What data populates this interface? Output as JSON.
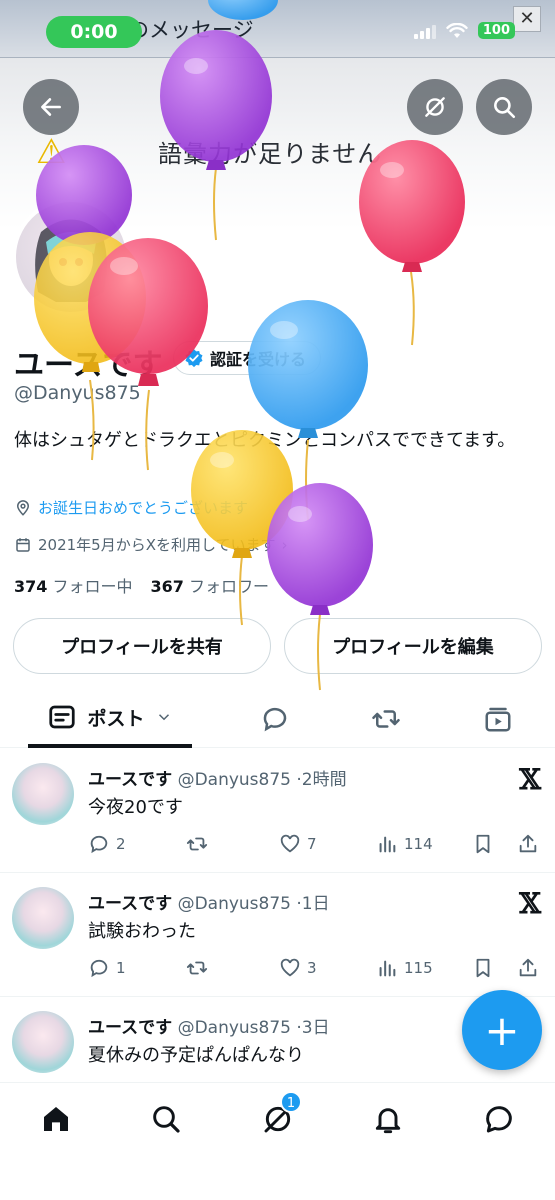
{
  "status_bar": {
    "time": "0:00",
    "battery": "100"
  },
  "banner": {
    "window_message": "のメッセージ",
    "warning_text": "語彙力が足りません"
  },
  "profile": {
    "name": "ユースです",
    "verify_label": "認証を受ける",
    "handle": "@Danyus875",
    "bio": "体はシュタゲとドラクエとピクミンとコンパスでできてます。",
    "birthday_text": "お誕生日おめでとうございます",
    "joined_text": "2021年5月からXを利用しています",
    "following_count": "374",
    "following_label": "フォロー中",
    "followers_count": "367",
    "followers_label": "フォロワー",
    "share_label": "プロフィールを共有",
    "edit_label": "プロフィールを編集"
  },
  "tabs": {
    "posts_label": "ポスト"
  },
  "posts": [
    {
      "name": "ユースです",
      "handle": "@Danyus875",
      "time": "2時間",
      "text": "今夜20です",
      "replies": "2",
      "likes": "7",
      "views": "114"
    },
    {
      "name": "ユースです",
      "handle": "@Danyus875",
      "time": "1日",
      "text": "試験おわった",
      "replies": "1",
      "likes": "3",
      "views": "115"
    },
    {
      "name": "ユースです",
      "handle": "@Danyus875",
      "time": "3日",
      "text": "夏休みの予定ぱんぱんなり",
      "replies": "",
      "likes": "",
      "views": ""
    }
  ],
  "compose": {
    "label": "+"
  },
  "bottom_nav": {
    "communities_badge": "1"
  },
  "colors": {
    "accent": "#1d9bf0",
    "purple_balloon": "#a946e0",
    "red_balloon": "#f2466b",
    "yellow_balloon": "#f6c82a",
    "blue_balloon": "#3fa9f5"
  }
}
